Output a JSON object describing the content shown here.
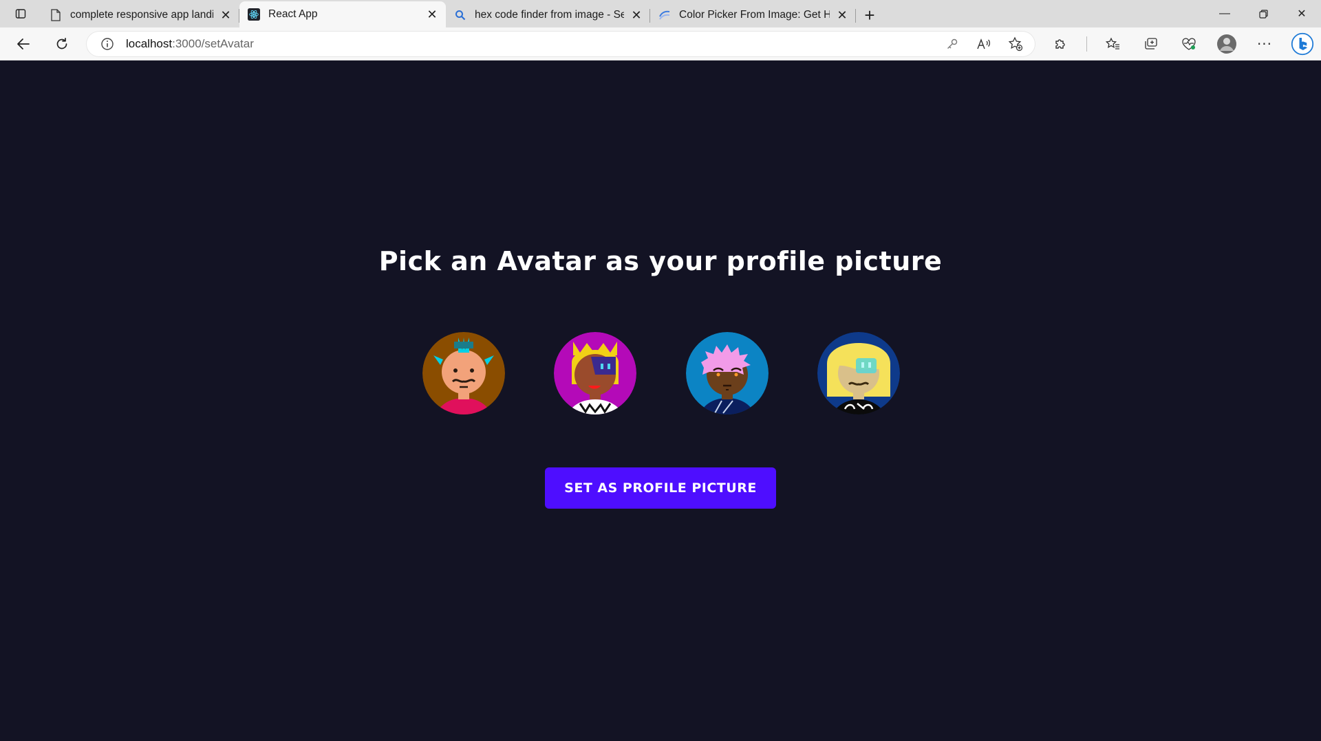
{
  "browser": {
    "tabs": [
      {
        "title": "complete responsive app landing",
        "favicon": "document-icon",
        "active": false
      },
      {
        "title": "React App",
        "favicon": "react-icon",
        "active": true
      },
      {
        "title": "hex code finder from image - Se",
        "favicon": "search-icon",
        "active": false
      },
      {
        "title": "Color Picker From Image: Get HE",
        "favicon": "color-picker-icon",
        "active": false
      }
    ],
    "address": {
      "host": "localhost",
      "path": ":3000/setAvatar"
    }
  },
  "page": {
    "heading": "Pick an Avatar as your profile picture",
    "avatars": [
      {
        "name": "avatar-1",
        "bg": "#8a4d00",
        "skin": "#f2a27a",
        "hair": "#00d0e6",
        "shirt": "#e0105c"
      },
      {
        "name": "avatar-2",
        "bg": "#b40ab8",
        "skin": "#9a4b2c",
        "hair": "#f1d016",
        "shirt": "#ffffff"
      },
      {
        "name": "avatar-3",
        "bg": "#0c84c4",
        "skin": "#6b3f1b",
        "hair": "#f29be8",
        "shirt": "#0b1f5e"
      },
      {
        "name": "avatar-4",
        "bg": "#0e3a8a",
        "skin": "#d9c08a",
        "hair": "#f5e15a",
        "shirt": "#0b0b0b"
      }
    ],
    "button_label": "Set as Profile Picture",
    "colors": {
      "background": "#131324",
      "button": "#4e0eff",
      "text": "#ffffff"
    }
  }
}
